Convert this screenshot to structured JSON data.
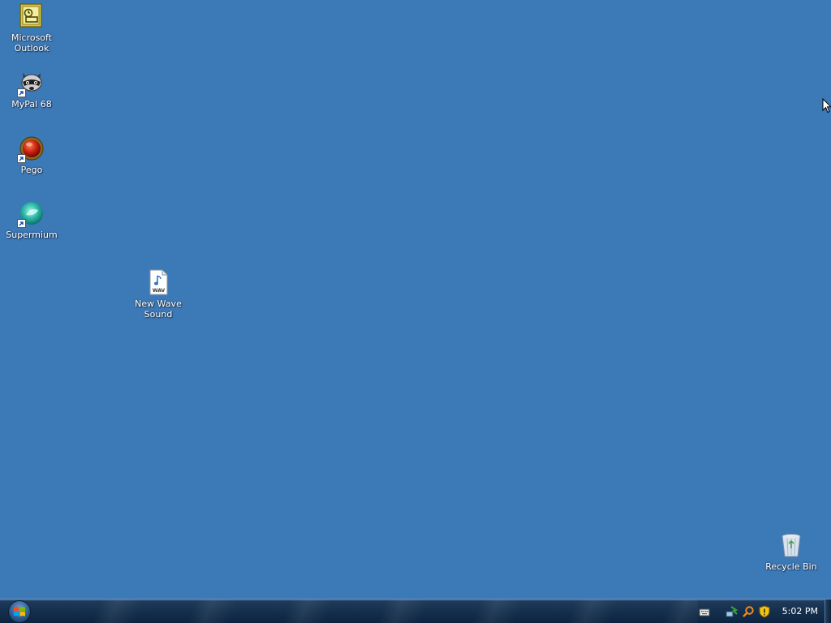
{
  "desktop": {
    "background_color": "#3c79b7",
    "icons": [
      {
        "label": "Microsoft\nOutlook",
        "icon": "outlook-icon"
      },
      {
        "label": "MyPal 68",
        "icon": "mypal-raccoon-icon"
      },
      {
        "label": "Pego",
        "icon": "pego-icon"
      },
      {
        "label": "Supermium",
        "icon": "supermium-icon"
      },
      {
        "label": "New Wave\nSound",
        "icon": "wav-file-icon"
      },
      {
        "label": "Recycle Bin",
        "icon": "recycle-bin-icon"
      }
    ]
  },
  "taskbar": {
    "start_button": "windows-orb-icon",
    "tray_icons": [
      "keyboard-icon",
      "network-icon",
      "search-icon",
      "security-shield-icon"
    ],
    "clock": "5:02 PM"
  }
}
